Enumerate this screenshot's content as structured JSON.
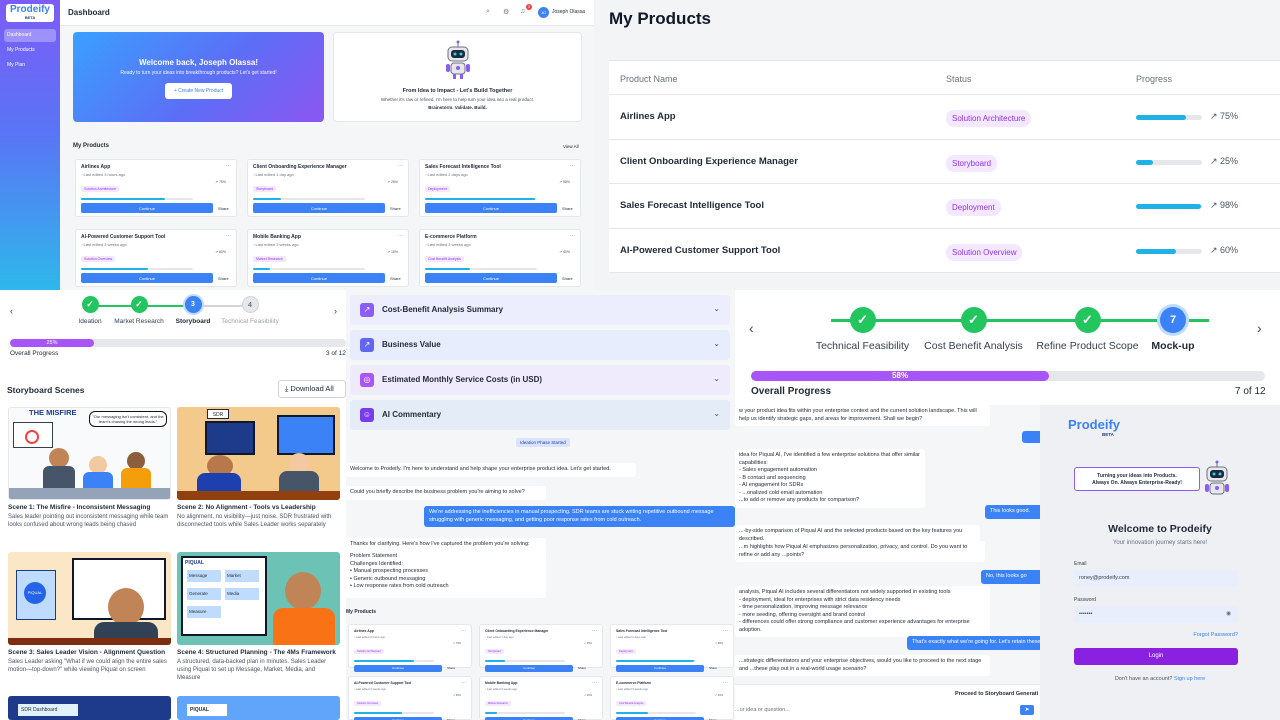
{
  "dashboard": {
    "logo": "Prodeify",
    "logo_badge": "BETA",
    "nav": [
      "Dashboard",
      "My Products",
      "My Plan"
    ],
    "header_title": "Dashboard",
    "notif_count": "3",
    "user_initials": "JO",
    "user_name": "Joseph Olassa",
    "welcome_title": "Welcome back, Joseph Olassa!",
    "welcome_sub": "Ready to turn your ideas into breakthrough products? Let's get started!",
    "create_btn": "Create New Product",
    "intro_title": "From Idea to Impact - Let's Build Together",
    "intro_sub": "Whether it's raw or refined, I'm here to help turn your idea into a real product.",
    "intro_tag": "Brainstorm. Validate. Build.",
    "section_title": "My Products",
    "view_all": "View All",
    "continue_label": "Continue",
    "share_label": "Share",
    "cards": [
      {
        "name": "Airlines App",
        "edited": "Last edited 3 hours ago",
        "tag": "Solution Architecture",
        "pct": "75%",
        "progress": 75
      },
      {
        "name": "Client Onboarding Experience Manager",
        "edited": "Last edited 1 day ago",
        "tag": "Storyboard",
        "pct": "25%",
        "progress": 25
      },
      {
        "name": "Sales Forecast Intelligence Tool",
        "edited": "Last edited 2 days ago",
        "tag": "Deployment",
        "pct": "98%",
        "progress": 98
      },
      {
        "name": "AI-Powered Customer Support Tool",
        "edited": "Last edited 3 weeks ago",
        "tag": "Solution Overview",
        "pct": "60%",
        "progress": 60
      },
      {
        "name": "Mobile Banking App",
        "edited": "Last edited 3 weeks ago",
        "tag": "Market Research",
        "pct": "15%",
        "progress": 15
      },
      {
        "name": "E-commerce Platform",
        "edited": "Last edited 3 weeks ago",
        "tag": "Cost Benefit Analysis",
        "pct": "40%",
        "progress": 40
      }
    ]
  },
  "products_table": {
    "title": "My Products",
    "headers": [
      "Product Name",
      "Status",
      "Progress"
    ],
    "rows": [
      {
        "name": "Airlines App",
        "status": "Solution Architecture",
        "pct": "75%",
        "progress": 75
      },
      {
        "name": "Client Onboarding Experience Manager",
        "status": "Storyboard",
        "pct": "25%",
        "progress": 25
      },
      {
        "name": "Sales Forecast Intelligence Tool",
        "status": "Deployment",
        "pct": "98%",
        "progress": 98
      },
      {
        "name": "AI-Powered Customer Support Tool",
        "status": "Solution Overview",
        "pct": "60%",
        "progress": 60
      }
    ]
  },
  "stepper1": {
    "steps": [
      "Ideation",
      "Market Research",
      "Storyboard",
      "Technical Feasibility"
    ],
    "step_nums": [
      "3",
      "4"
    ],
    "progress_label": "25%",
    "progress": 25,
    "overall": "Overall Progress",
    "count": "3 of 12"
  },
  "scenes": {
    "title": "Storyboard Scenes",
    "download": "Download All",
    "img_text": {
      "misfire": "THE MISFIRE",
      "bubble": "\"Our messaging isn't consistent, and the team's chasing the wrong leads.\"",
      "sdr": "SDR",
      "piqual": "PIQUAL",
      "msg": "Message",
      "market": "Market",
      "media": "Media",
      "measure": "Measure",
      "generate": "Generate",
      "sdr_dash": "SDR Dashboard"
    },
    "items": [
      {
        "title": "Scene 1: The Misfire - Inconsistent Messaging",
        "desc": "Sales leader pointing out inconsistent messaging while team looks confused about wrong leads being chased"
      },
      {
        "title": "Scene 2: No Alignment - Tools vs Leadership",
        "desc": "No alignment, no visibility—just noise. SDR frustrated with disconnected tools while Sales Leader works separately"
      },
      {
        "title": "Scene 3: Sales Leader Vision - Alignment Question",
        "desc": "Sales Leader asking \"What if we could align the entire sales motion—top-down?\" while viewing Piqual on screen"
      },
      {
        "title": "Scene 4: Structured Planning - The 4Ms Framework",
        "desc": "A structured, data-backed plan in minutes. Sales Leader using Piqual to set up Message, Market, Media, and Measure"
      }
    ]
  },
  "accordions": [
    "Cost-Benefit Analysis Summary",
    "Business Value",
    "Estimated Monthly Service Costs (in USD)",
    "AI Commentary"
  ],
  "chat1": {
    "phase": "Ideation Phase Started",
    "m1": "Welcome to Prodeify. I'm here to understand and help shape your enterprise product idea. Let's get started.",
    "m2": "Could you briefly describe the business problem you're aiming to solve?",
    "u1": "We're addressing the inefficiencies in manual prospecting. SDR teams are stuck writing repetitive outbound message struggling with generic messaging, and getting poor response rates from cold outreach.",
    "m3": "Thanks for clarifying. Here's how I've captured the problem you're solving:",
    "m4": [
      "Problem Statement",
      "Challenges Identified:",
      "• Manual prospecting processes",
      "• Generic outbound messaging",
      "• Low response rates from cold outreach"
    ],
    "section": "My Products",
    "cards": [
      {
        "name": "Airlines App",
        "edited": "Last edited 3 hours ago",
        "tag": "Solution Architecture",
        "pct": "75%",
        "progress": 75
      },
      {
        "name": "Client Onboarding Experience Manager",
        "edited": "Last edited 1 day ago",
        "tag": "Storyboard",
        "pct": "25%",
        "progress": 25
      },
      {
        "name": "Sales Forecast Intelligence Tool",
        "edited": "Last edited 2 days ago",
        "tag": "Deployment",
        "pct": "98%",
        "progress": 98
      },
      {
        "name": "AI-Powered Customer Support Tool",
        "edited": "Last edited 3 weeks ago",
        "tag": "Solution Overview",
        "pct": "60%",
        "progress": 60
      },
      {
        "name": "Mobile Banking App",
        "edited": "Last edited 3 weeks ago",
        "tag": "Market Research",
        "pct": "15%",
        "progress": 15
      },
      {
        "name": "E-commerce Platform",
        "edited": "Last edited 3 weeks ago",
        "tag": "Cost Benefit Analysis",
        "pct": "40%",
        "progress": 40
      }
    ]
  },
  "stepper2": {
    "steps": [
      "Technical Feasibility",
      "Cost Benefit Analysis",
      "Refine Product Scope",
      "Mock-up"
    ],
    "current_num": "7",
    "progress_label": "58%",
    "progress": 58,
    "overall": "Overall Progress",
    "count": "7 of 12"
  },
  "chat2": {
    "m1": "w your product idea fits within your enterprise context and the current solution landscape. This will help us identify strategic gaps, and areas for improvement. Shall we begin?",
    "m2": [
      "idea for Piqual AI, I've identified a few enterprise solutions that offer similar capabilities:",
      "- Sales engagement automation",
      "- B contact and sequencing",
      "- AI engagement for SDRs",
      "- ...onalized cold email automation",
      "...to add or remove any products for comparison?"
    ],
    "u1": "This looks good.",
    "m3": "...-by-side comparison of Piqual AI and the selected products based on the key features you described.",
    "m4": "...m highlights how Piqual AI emphasizes personalization, privacy, and control. Do you want to refine or add any ...points?",
    "u2": "No, this looks go",
    "m5": [
      "analysis, Piqual AI includes several differentiators not widely supported in existing tools",
      "- deployment, ideal for enterprises with strict data residency needs",
      "- time personalization, improving message relevance",
      "- more seeding, offering oversight and brand control",
      "- differences could offer strong compliance and customer experience advantages for enterprise adoption."
    ],
    "u3": "That's exactly what we're going for. Let's retain these",
    "m6": "...strategic differentiators and your enterprise objectives, would you like to proceed to the next stage and ...these play out in a real-world usage scenario?",
    "proceed": "Proceed to Storyboard Generati",
    "input_ph": "...ur idea or question..."
  },
  "login": {
    "logo": "Prodeify",
    "badge": "BETA",
    "bubble1": "Turning your ideas into Products.",
    "bubble2": "Always On. Always Enterprise-Ready!",
    "title": "Welcome to Prodeify",
    "subtitle": "Your innovation journey starts here!",
    "email_label": "Email",
    "email_value": "roney@prodeify.com",
    "password_label": "Password",
    "password_value": "•••••••",
    "forgot": "Forgot Password?",
    "login_btn": "Login",
    "no_account": "Don't have an account?",
    "signup": "Sign up here"
  },
  "colors": {
    "primary": "#3b82f6",
    "accent": "#8b5cf6",
    "progress": "#1fb2e6",
    "success": "#22c55e",
    "tag_bg": "#f3e8ff",
    "tag_text": "#9333ea",
    "login_btn": "#8b21e0"
  }
}
